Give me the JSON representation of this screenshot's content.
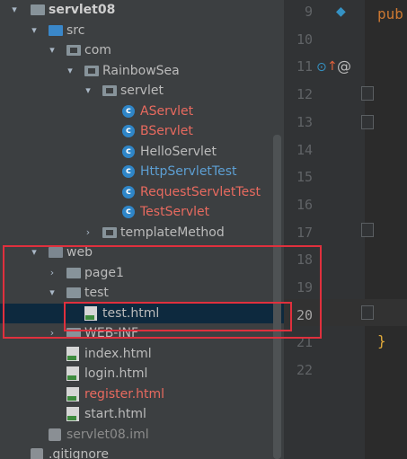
{
  "tree": {
    "nodes": [
      {
        "label": "servlet08",
        "color": "bold",
        "arrow": "▾",
        "icon": "module-folder"
      },
      {
        "label": "src",
        "color": "def",
        "arrow": "▾",
        "icon": "source-folder"
      },
      {
        "label": "com",
        "color": "def",
        "arrow": "▾",
        "icon": "package-folder"
      },
      {
        "label": "RainbowSea",
        "color": "def",
        "arrow": "▾",
        "icon": "package-folder"
      },
      {
        "label": "servlet",
        "color": "def",
        "arrow": "▾",
        "icon": "package-folder"
      },
      {
        "label": "AServlet",
        "color": "red",
        "arrow": "",
        "icon": "class-icon"
      },
      {
        "label": "BServlet",
        "color": "red",
        "arrow": "",
        "icon": "class-icon"
      },
      {
        "label": "HelloServlet",
        "color": "def",
        "arrow": "",
        "icon": "class-icon"
      },
      {
        "label": "HttpServletTest",
        "color": "blue",
        "arrow": "",
        "icon": "class-icon"
      },
      {
        "label": "RequestServletTest",
        "color": "red",
        "arrow": "",
        "icon": "class-icon"
      },
      {
        "label": "TestServlet",
        "color": "red",
        "arrow": "",
        "icon": "class-icon"
      },
      {
        "label": "templateMethod",
        "color": "def",
        "arrow": "›",
        "icon": "package-folder"
      },
      {
        "label": "web",
        "color": "def",
        "arrow": "▾",
        "icon": "web-folder"
      },
      {
        "label": "page1",
        "color": "def",
        "arrow": "›",
        "icon": "folder"
      },
      {
        "label": "test",
        "color": "def",
        "arrow": "▾",
        "icon": "folder"
      },
      {
        "label": "test.html",
        "color": "def",
        "arrow": "",
        "icon": "html-file"
      },
      {
        "label": "WEB-INF",
        "color": "def",
        "arrow": "›",
        "icon": "folder"
      },
      {
        "label": "index.html",
        "color": "def",
        "arrow": "",
        "icon": "html-file"
      },
      {
        "label": "login.html",
        "color": "def",
        "arrow": "",
        "icon": "html-file"
      },
      {
        "label": "register.html",
        "color": "red",
        "arrow": "",
        "icon": "html-file"
      },
      {
        "label": "start.html",
        "color": "def",
        "arrow": "",
        "icon": "html-file"
      },
      {
        "label": "servlet08.iml",
        "color": "gray",
        "arrow": "",
        "icon": "iml-file"
      },
      {
        "label": ".gitignore",
        "color": "def",
        "arrow": "",
        "icon": "file"
      }
    ],
    "selected": "test.html"
  },
  "editor": {
    "line_numbers": [
      "9",
      "10",
      "11",
      "12",
      "13",
      "14",
      "15",
      "16",
      "17",
      "18",
      "19",
      "20",
      "21",
      "22"
    ],
    "current_line": "20",
    "code_keyword": "pub",
    "code_brace": "}"
  },
  "colors": {
    "panel": "#3c3f41",
    "selection": "#0d293e",
    "highlight_box": "#e0303d"
  }
}
